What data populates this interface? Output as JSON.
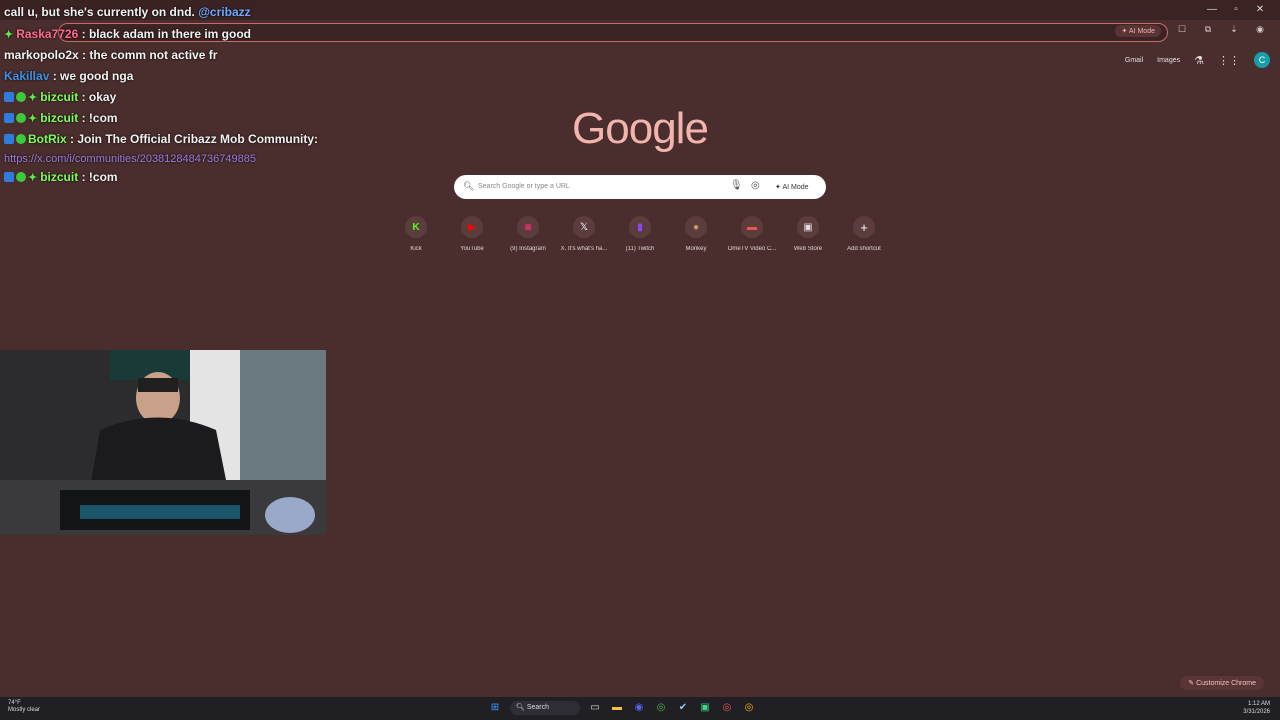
{
  "chat": {
    "line1": {
      "text": "call u, but she's currently on dnd.",
      "mention": "@cribazz"
    },
    "line2": {
      "user": "Raska7726",
      "text": ": black adam in there im good"
    },
    "line3": {
      "user": "markopolo2x",
      "text": ": the comm not active fr"
    },
    "line4": {
      "user": "Kakillav",
      "text": ": we good nga"
    },
    "line5": {
      "user": "bizcuit",
      "text": ": okay"
    },
    "line6": {
      "user": "bizcuit",
      "text": ": !com"
    },
    "line7": {
      "user": "BotRix",
      "text": ": Join The Official Cribazz Mob Community:"
    },
    "line8": {
      "link": "https://x.com/i/communities/2038128484736749885"
    },
    "line9": {
      "user": "bizcuit",
      "text": ": !com"
    }
  },
  "toolbar": {
    "ai_mode_label": "AI Mode"
  },
  "google": {
    "gmail": "Gmail",
    "images": "Images",
    "avatar_letter": "C",
    "logo": "Google",
    "search_placeholder": "Search Google or type a URL",
    "ai_mode": "AI Mode",
    "shortcuts": [
      {
        "label": "Kick",
        "icon": "kick-icon",
        "color": "#53fc18"
      },
      {
        "label": "YouTube",
        "icon": "youtube-icon",
        "color": "#ff0000"
      },
      {
        "label": "(9) Instagram",
        "icon": "instagram-icon",
        "color": "#e1306c"
      },
      {
        "label": "X. It's what's ha...",
        "icon": "x-icon",
        "color": "#ffffff"
      },
      {
        "label": "(11) Twitch",
        "icon": "twitch-icon",
        "color": "#9146ff"
      },
      {
        "label": "Monkey",
        "icon": "monkey-icon",
        "color": "#c8a060"
      },
      {
        "label": "OmeTV Video C...",
        "icon": "ometv-icon",
        "color": "#f05050"
      },
      {
        "label": "Web Store",
        "icon": "webstore-icon",
        "color": "#e0e0e0"
      },
      {
        "label": "Add shortcut",
        "icon": "plus-icon",
        "color": "#ffffff"
      }
    ],
    "customize": "Customize Chrome"
  },
  "taskbar": {
    "weather_temp": "74°F",
    "weather_desc": "Mostly clear",
    "search": "Search",
    "time": "1:12 AM",
    "date": "3/31/2026"
  }
}
